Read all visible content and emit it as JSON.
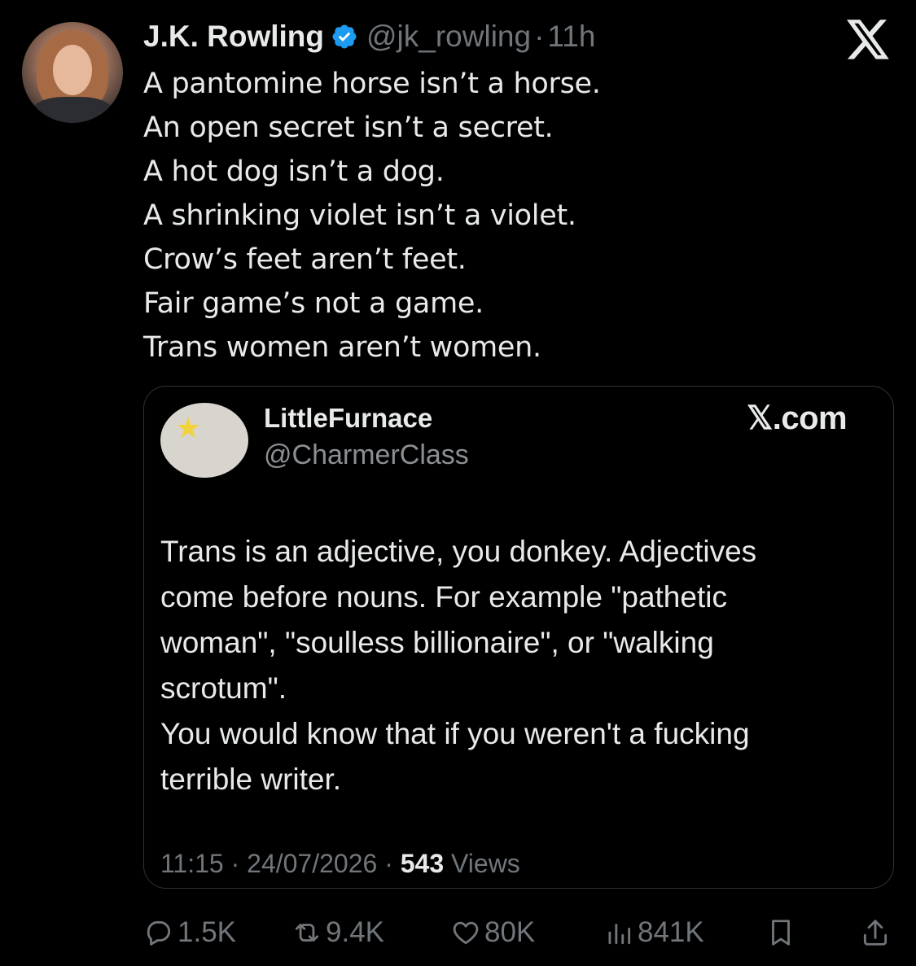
{
  "author": {
    "display_name": "J.K. Rowling",
    "handle": "@jk_rowling",
    "separator": "·",
    "time": "11h",
    "verified_icon": "verified-badge-icon",
    "verified_color": "#1d9bf0"
  },
  "platform_logo": "x-logo-icon",
  "tweet_lines": [
    "A pantomine horse isn’t a horse.",
    "An open secret isn’t a secret.",
    "A hot dog isn’t a dog.",
    "A shrinking violet isn’t a violet.",
    "Crow’s feet aren’t feet.",
    "Fair game’s not a game.",
    "Trans women aren’t women."
  ],
  "quote": {
    "display_name": "LittleFurnace",
    "handle": "@CharmerClass",
    "brand": "𝕏.com",
    "text_lines": [
      "Trans is an adjective, you donkey. Adjectives",
      "come before nouns. For example \"pathetic",
      "woman\", \"soulless billionaire\", or \"walking",
      "scrotum\".",
      "You would know that if you weren't a fucking",
      "terrible writer."
    ],
    "timestamp": "11:15 · 24/07/2026 · ",
    "views_count": "543",
    "views_label": " Views"
  },
  "actions": {
    "reply": {
      "icon": "reply-icon",
      "count": "1.5K"
    },
    "repost": {
      "icon": "repost-icon",
      "count": "9.4K"
    },
    "like": {
      "icon": "heart-icon",
      "count": "80K"
    },
    "views": {
      "icon": "views-chart-icon",
      "count": "841K"
    },
    "bookmark": {
      "icon": "bookmark-icon"
    },
    "share": {
      "icon": "share-icon"
    }
  },
  "colors": {
    "background": "#000000",
    "text": "#e7e9ea",
    "muted": "#71767b",
    "border": "#2f3336"
  }
}
